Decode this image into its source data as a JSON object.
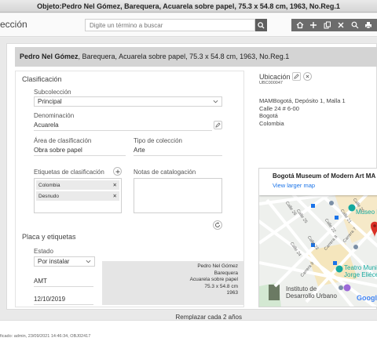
{
  "window": {
    "title": "Objeto:Pedro Nel Gómez, Barequera, Acuarela sobre papel, 75.3 x 54.8 cm, 1963, No.Reg.1"
  },
  "app": {
    "section_title": "ección"
  },
  "search": {
    "placeholder": "Digite un término a buscar"
  },
  "record": {
    "artist": "Pedro Nel Gómez",
    "rest": ", Barequera, Acuarela sobre papel, 75.3 x 54.8 cm, 1963, No.Reg.1"
  },
  "clasificacion": {
    "section_label": "Clasificación",
    "subcoleccion_label": "Subcolección",
    "subcoleccion_value": "Principal",
    "denominacion_label": "Denominación",
    "denominacion_value": "Acuarela",
    "area_label": "Área de clasificación",
    "area_value": "Obra sobre papel",
    "tipo_label": "Tipo de colección",
    "tipo_value": "Arte",
    "etiquetas_label": "Etiquetas de clasificación",
    "etiquetas": [
      "Colombia",
      "Desnudo"
    ],
    "notas_label": "Notas de catalogación"
  },
  "placa": {
    "section_label": "Placa y etiquetas",
    "estado_label": "Estado",
    "estado_value": "Por instalar",
    "code": "AMT",
    "date": "12/10/2019",
    "label_lines": [
      "Pedro Nel Gómez",
      "Barequera",
      "Acuarela sobre papel",
      "75.3 x 54.8 cm",
      "1963"
    ],
    "reemplazar": "Remplazar cada 2 años"
  },
  "ubicacion": {
    "title": "Ubicación",
    "code": "UBC000047",
    "lines": [
      "MAMBogotá, Depósito 1, Malla 1",
      "Calle 24 # 6-00",
      "Bogotá",
      "Colombia"
    ]
  },
  "map": {
    "place_name": "Bogotá Museum of Modern Art MA",
    "link": "View larger map",
    "label_museo": "Museo D",
    "label_teatro_1": "Teatro Muni",
    "label_teatro_2": "Jorge Eliéce",
    "label_instituto_1": "Instituto de",
    "label_instituto_2": "Desarrollo Urbano",
    "google": "Google",
    "streets": [
      "Calle 26",
      "Calle 25",
      "Calle 24",
      "Carrera 9",
      "Calle 23",
      "Carrera 8",
      "Calle 22",
      "Carrera 7",
      "Calle 21",
      "Calle 20"
    ],
    "colors": {
      "road": "#ffffff",
      "water": "#bde3f2",
      "pin": "#d93025",
      "link": "#1a73e8"
    }
  },
  "footer": {
    "text": "ficado: admin, 23/09/2021 14:46:34, OBJ02417"
  }
}
